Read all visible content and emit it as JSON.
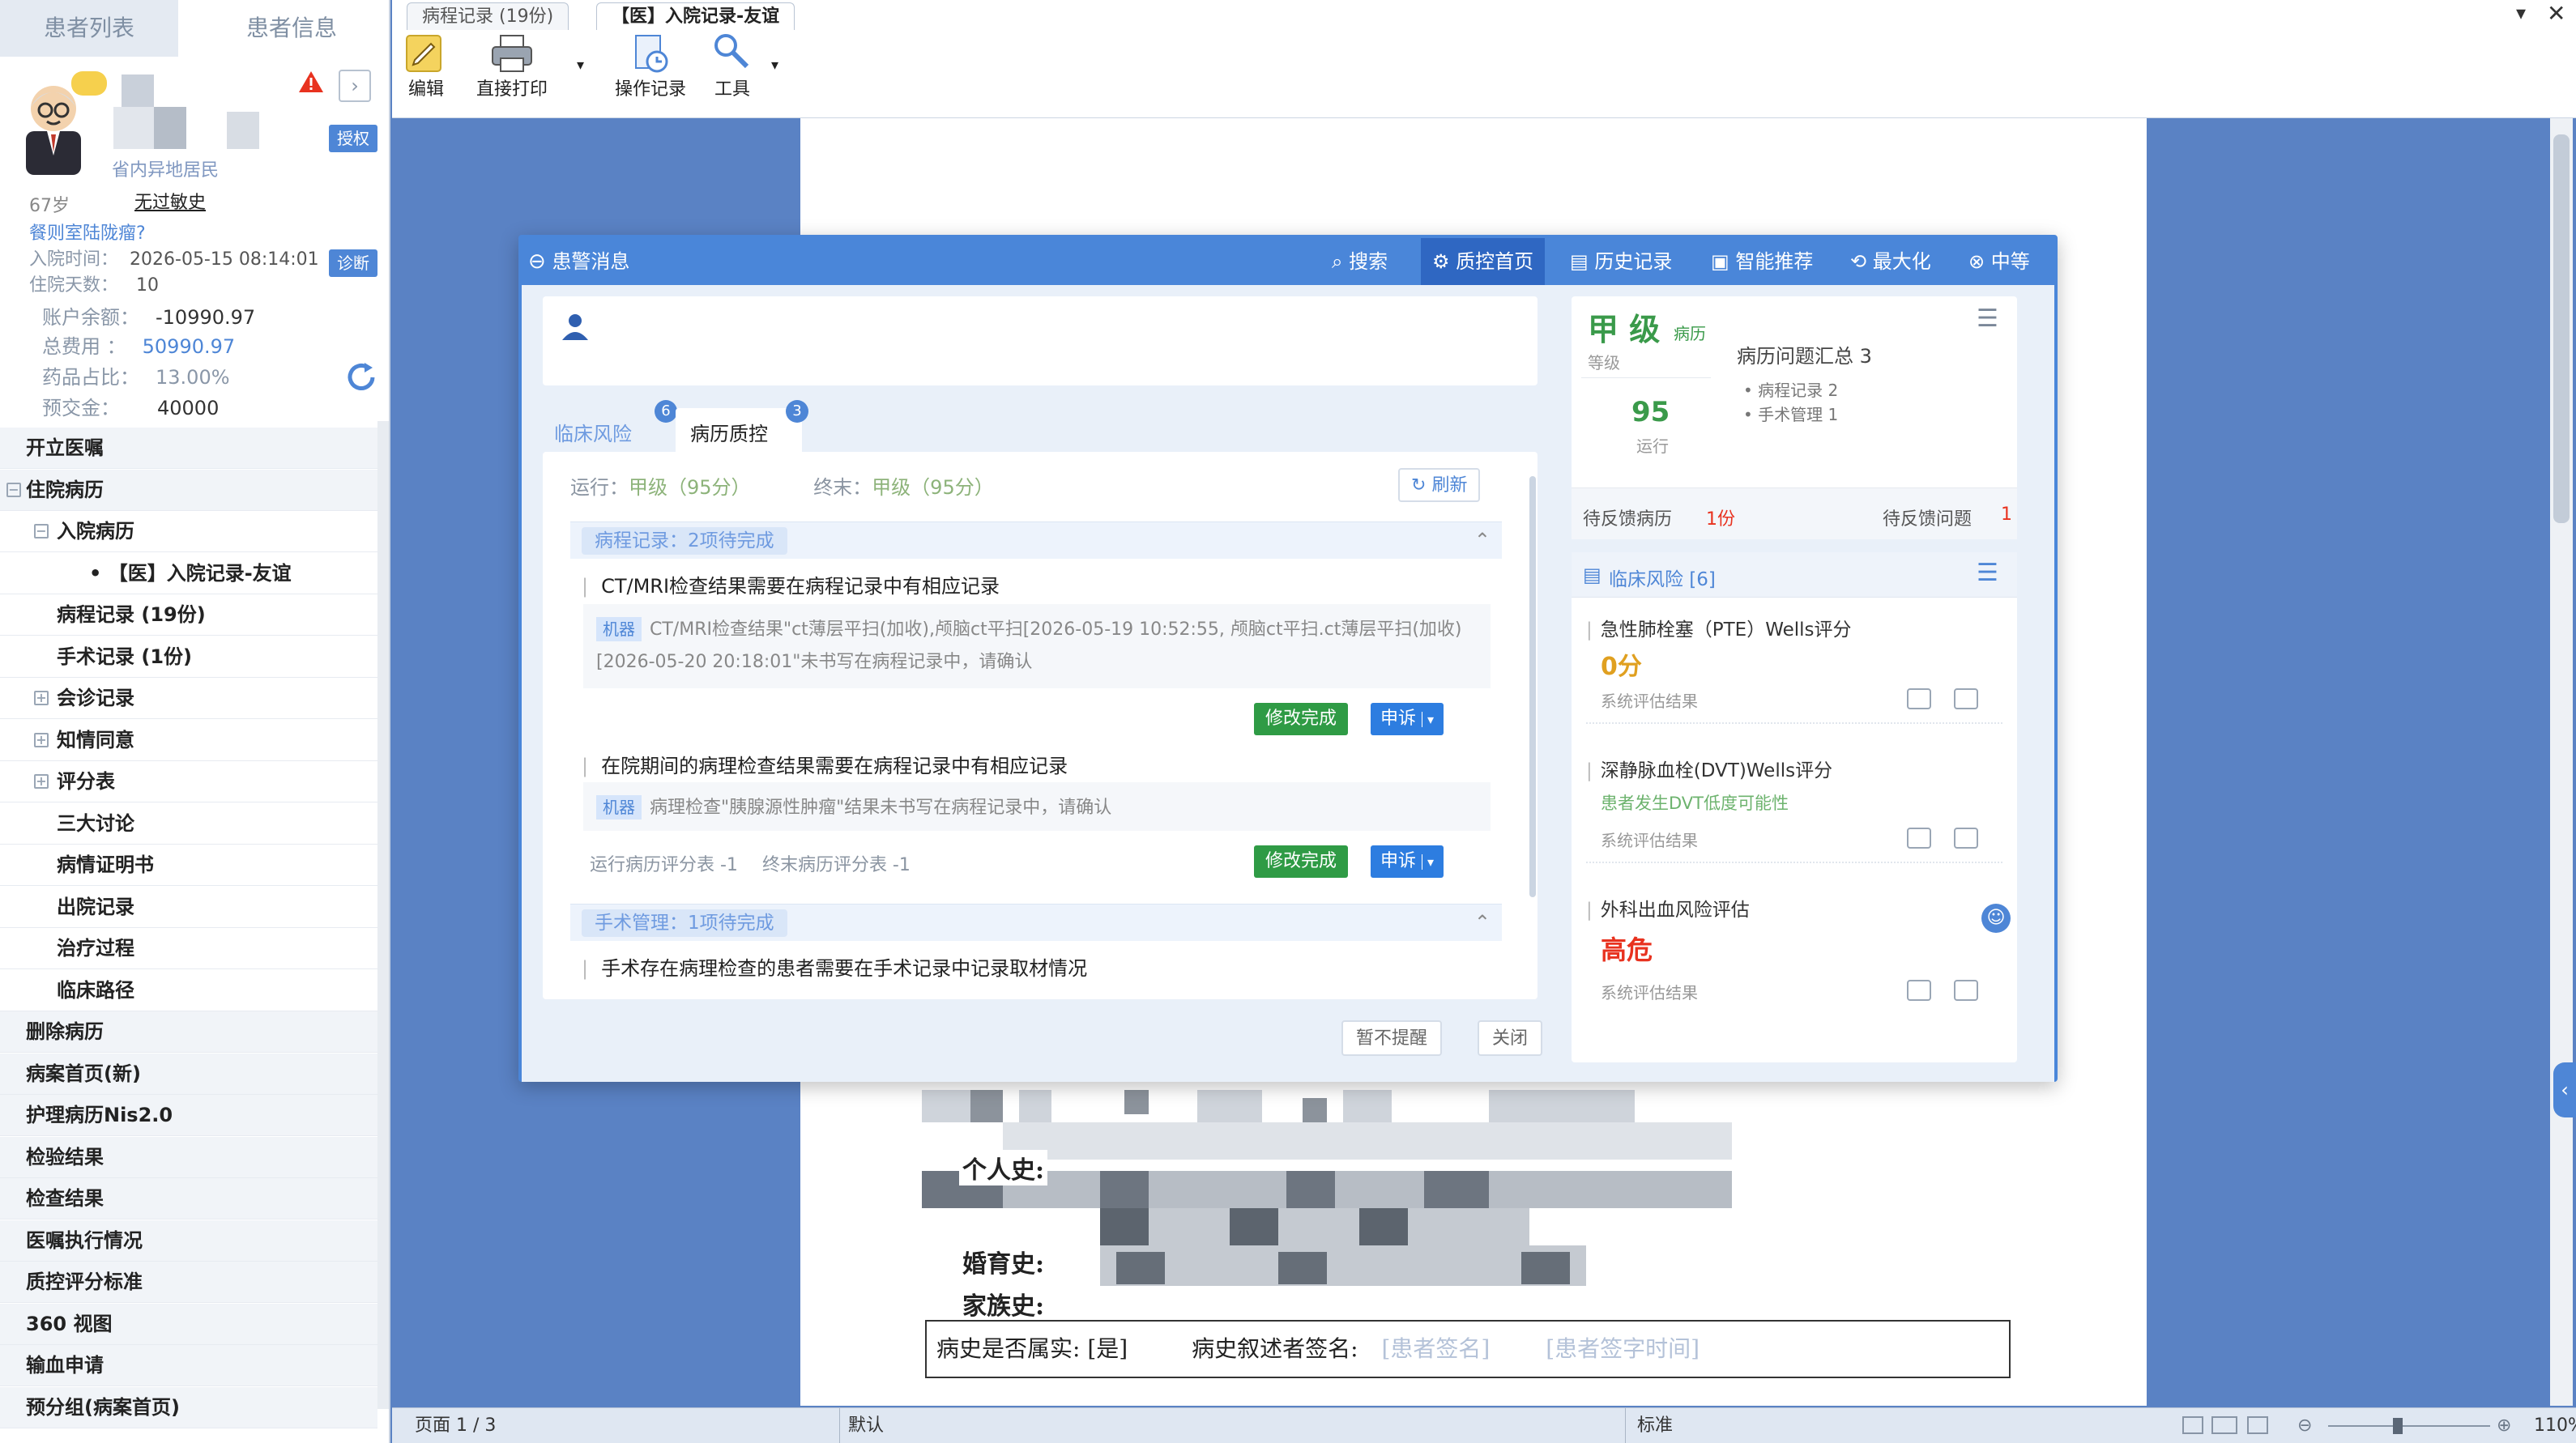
{
  "sidebar": {
    "tab_list": "患者列表",
    "tab_info": "患者信息",
    "patient": {
      "insurance_tag": "省内异地居民",
      "auth_button": "授权",
      "age": "67岁",
      "allergy": "无过敏史",
      "diagnosis": "餐则室陆陇瘤?",
      "admit_label": "入院时间：",
      "admit_time": "2026-05-15 08:14:01",
      "diag_button": "诊断",
      "days_label": "住院天数：",
      "days": "10",
      "balance_label": "账户余额：",
      "balance": "-10990.97",
      "total_label": "总费用   ：",
      "total": "50990.97",
      "drug_label": "药品占比：",
      "drug_ratio": "13.00%",
      "prepay_label": "预交金：",
      "prepay": "40000"
    },
    "nav": [
      {
        "label": "开立医嘱",
        "level": 0
      },
      {
        "label": "住院病历",
        "level": 0,
        "toggle": "−"
      },
      {
        "label": "入院病历",
        "level": 1,
        "toggle": "−"
      },
      {
        "label": "• 【医】入院记录-友谊",
        "level": 2
      },
      {
        "label": "病程记录 (19份)",
        "level": 1
      },
      {
        "label": "手术记录 (1份)",
        "level": 1
      },
      {
        "label": "会诊记录",
        "level": 1,
        "toggle": "+"
      },
      {
        "label": "知情同意",
        "level": 1,
        "toggle": "+"
      },
      {
        "label": "评分表",
        "level": 1,
        "toggle": "+"
      },
      {
        "label": "三大讨论",
        "level": 1
      },
      {
        "label": "病情证明书",
        "level": 1
      },
      {
        "label": "出院记录",
        "level": 1
      },
      {
        "label": "治疗过程",
        "level": 1
      },
      {
        "label": "临床路径",
        "level": 1
      },
      {
        "label": "删除病历",
        "level": 0
      },
      {
        "label": "病案首页(新)",
        "level": 0
      },
      {
        "label": "护理病历Nis2.0",
        "level": 0
      },
      {
        "label": "检验结果",
        "level": 0
      },
      {
        "label": "检查结果",
        "level": 0
      },
      {
        "label": "医嘱执行情况",
        "level": 0
      },
      {
        "label": "质控评分标准",
        "level": 0
      },
      {
        "label": "360 视图",
        "level": 0
      },
      {
        "label": "输血申请",
        "level": 0
      },
      {
        "label": "预分组(病案首页)",
        "level": 0
      }
    ]
  },
  "tabs": {
    "t1": "病程记录 (19份)",
    "t2": "【医】入院记录-友谊"
  },
  "toolbar": {
    "edit": "编辑",
    "print": "直接打印",
    "oplog": "操作记录",
    "tools": "工具"
  },
  "dialog": {
    "title": "患警消息",
    "search": "搜索",
    "home": "质控首页",
    "history": "历史记录",
    "recommend": "智能推荐",
    "maximize": "最大化",
    "minimize": "中等",
    "tab_clinical": "临床风险",
    "tab_quality": "病历质控",
    "badge_clinical": "6",
    "badge_quality": "3",
    "run_label": "运行：",
    "run_value": "甲级（95分）",
    "end_label": "终末：",
    "end_value": "甲级（95分）",
    "refresh": "刷新",
    "sec1": "病程记录：2项待完成",
    "item1_title": "CT/MRI检查结果需要在病程记录中有相应记录",
    "item1_tag": "机器",
    "item1_text": "CT/MRI检查结果\"ct薄层平扫(加收),颅脑ct平扫[2026-05-19 10:52:55, 颅脑ct平扫.ct薄层平扫(加收)[2026-05-20 20:18:01\"未书写在病程记录中，请确认",
    "fix_done": "修改完成",
    "appeal": "申诉",
    "item2_title": "在院期间的病理检查结果需要在病程记录中有相应记录",
    "item2_tag": "机器",
    "item2_text": "病理检查\"胰腺源性肿瘤\"结果未书写在病程记录中，请确认",
    "score_run": "运行病历评分表 -1",
    "score_end": "终末病历评分表 -1",
    "sec2": "手术管理：1项待完成",
    "item3_title": "手术存在病理检查的患者需要在手术记录中记录取材情况",
    "no_remind": "暂不提醒",
    "close": "关闭",
    "grade": "甲 级",
    "grade_suffix": "病历",
    "grade_label": "等级",
    "score": "95",
    "score_label": "运行",
    "summary_title": "病历问题汇总 3",
    "summary_items": [
      "• 病程记录 2",
      "• 手术管理 1"
    ],
    "pending_records_label": "待反馈病历",
    "pending_records": "1份",
    "pending_issues_label": "待反馈问题",
    "pending_issues": "1",
    "risk_header": "临床风险 [6]",
    "risk1_title": "急性肺栓塞（PTE）Wells评分",
    "risk1_value": "0分",
    "risk1_note": "系统评估结果",
    "risk2_title": "深静脉血栓(DVT)Wells评分",
    "risk2_value": "患者发生DVT低度可能性",
    "risk2_note": "系统评估结果",
    "risk3_title": "外科出血风险评估",
    "risk3_value": "高危",
    "risk3_note": "系统评估结果"
  },
  "doc": {
    "personal": "个人史:",
    "marital": "婚育史:",
    "family": "家族史:",
    "verify": "病史是否属实: [是]",
    "narrator": "病史叙述者签名:",
    "sig_placeholder": "[患者签名]",
    "time_placeholder": "[患者签字时间]"
  },
  "status": {
    "page": "页面 1 / 3",
    "mode": "默认",
    "std": "标准",
    "zoom": "110%"
  },
  "colors": {
    "accent": "#4a86d9",
    "danger": "#e8321f",
    "ok": "#2f9b45"
  }
}
